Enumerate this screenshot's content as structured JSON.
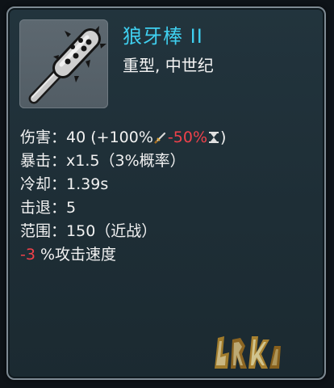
{
  "item": {
    "name": "狼牙棒 II",
    "subtitle": "重型, 中世纪",
    "icon": "spiked-mace-icon"
  },
  "stats": {
    "damage": {
      "label": "伤害",
      "colon": "：",
      "value_prefix": "40 (+100%",
      "sword_icon": "sword-icon",
      "penalty": "-50%",
      "hourglass_icon": "hourglass-icon",
      "value_suffix": ")"
    },
    "crit": {
      "label": "暴击",
      "colon": "：",
      "value": "x1.5（3%概率）"
    },
    "cooldown": {
      "label": "冷却",
      "colon": "：",
      "value": "1.39s"
    },
    "knockback": {
      "label": "击退",
      "colon": "：",
      "value": "5"
    },
    "range": {
      "label": "范围",
      "colon": "：",
      "value": "150（近战）"
    },
    "attack_speed": {
      "modifier": "-3",
      "text": "%攻击速度"
    }
  },
  "colors": {
    "name": "#3fd0f0",
    "negative": "#f0414a",
    "text": "#f2f2f2",
    "panel_border": "#7e8a93"
  }
}
